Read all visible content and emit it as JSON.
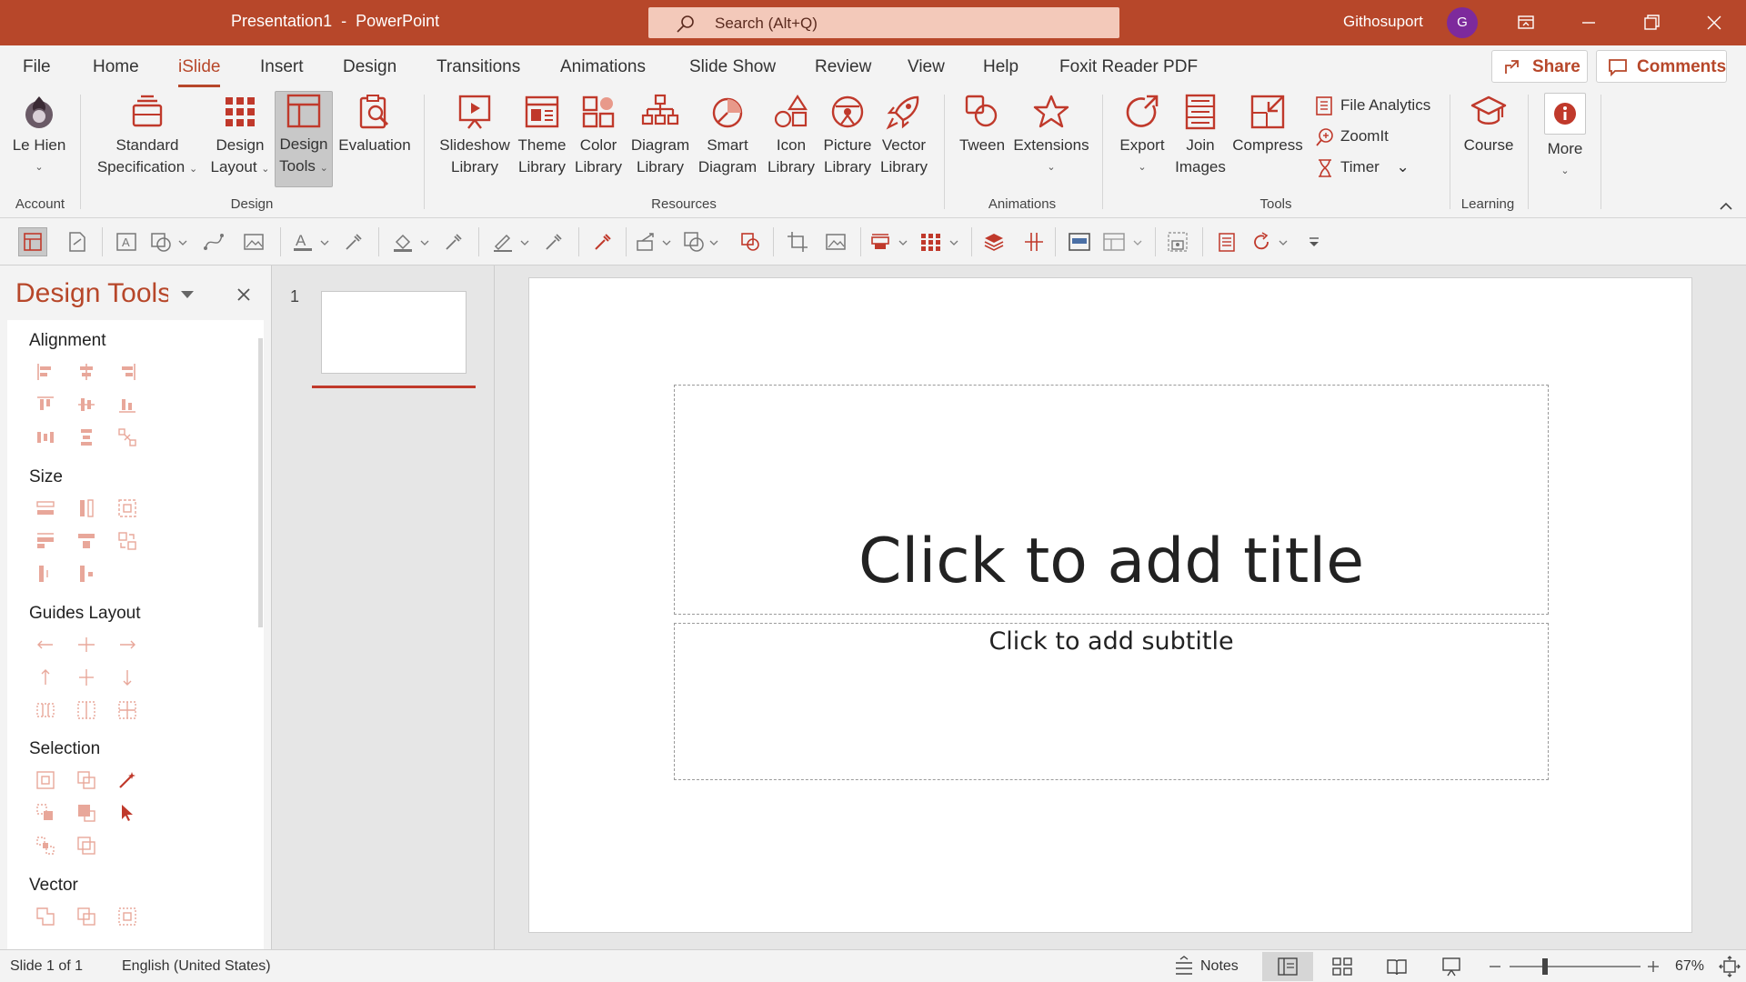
{
  "window": {
    "title": "Presentation1  -  PowerPoint",
    "search_placeholder": "Search (Alt+Q)",
    "user": "Githosuport",
    "avatar_initial": "G"
  },
  "colors": {
    "accent": "#b7472a",
    "avatar": "#7d2a9c"
  },
  "tabs": [
    "File",
    "Home",
    "iSlide",
    "Insert",
    "Design",
    "Transitions",
    "Animations",
    "Slide Show",
    "Review",
    "View",
    "Help",
    "Foxit Reader PDF"
  ],
  "active_tab": "iSlide",
  "share_label": "Share",
  "comments_label": "Comments",
  "ribbon": {
    "account": {
      "label1": "Le Hien",
      "group": "Account"
    },
    "design": {
      "std1": "Standard",
      "std2": "Specification",
      "dl1": "Design",
      "dl2": "Layout",
      "dt1": "Design",
      "dt2": "Tools",
      "eval": "Evaluation",
      "group": "Design"
    },
    "resources": {
      "ss1": "Slideshow",
      "ss2": "Library",
      "th1": "Theme",
      "th2": "Library",
      "co1": "Color",
      "co2": "Library",
      "di1": "Diagram",
      "di2": "Library",
      "sm1": "Smart",
      "sm2": "Diagram",
      "ic1": "Icon",
      "ic2": "Library",
      "pi1": "Picture",
      "pi2": "Library",
      "ve1": "Vector",
      "ve2": "Library",
      "group": "Resources"
    },
    "animations": {
      "tween": "Tween",
      "ext": "Extensions",
      "group": "Animations"
    },
    "tools": {
      "export": "Export",
      "join1": "Join",
      "join2": "Images",
      "compress": "Compress",
      "file_analytics": "File Analytics",
      "zoomit": "ZoomIt",
      "timer": "Timer",
      "group": "Tools"
    },
    "learning": {
      "course": "Course",
      "group": "Learning"
    },
    "more": "More"
  },
  "panel": {
    "title": "Design Tools",
    "sections": [
      "Alignment",
      "Size",
      "Guides Layout",
      "Selection",
      "Vector"
    ]
  },
  "thumbs": {
    "slide_number": "1"
  },
  "slide": {
    "title_placeholder": "Click to add title",
    "subtitle_placeholder": "Click to add subtitle"
  },
  "status": {
    "slide": "Slide 1 of 1",
    "language": "English (United States)",
    "notes": "Notes",
    "zoom": "67%"
  }
}
